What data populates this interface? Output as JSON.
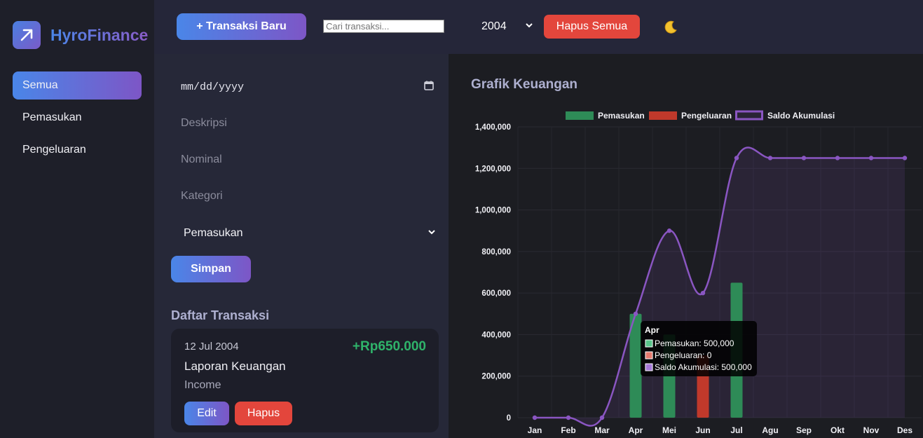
{
  "app": {
    "name": "HyroFinance"
  },
  "sidebar": {
    "items": [
      {
        "label": "Semua",
        "active": true
      },
      {
        "label": "Pemasukan",
        "active": false
      },
      {
        "label": "Pengeluaran",
        "active": false
      }
    ]
  },
  "header": {
    "new_button": "+ Transaksi Baru",
    "search_placeholder": "Cari transaksi...",
    "year": "2004",
    "clear_button": "Hapus Semua",
    "theme_icon": "moon-icon"
  },
  "form": {
    "date_placeholder": "mm/dd/yyyy",
    "description_placeholder": "Deskripsi",
    "amount_placeholder": "Nominal",
    "category_placeholder": "Kategori",
    "type_selected": "Pemasukan",
    "save_button": "Simpan"
  },
  "transactions": {
    "title": "Daftar Transaksi",
    "items": [
      {
        "date": "12 Jul 2004",
        "amount": "+Rp650.000",
        "description": "Laporan Keuangan",
        "category": "Income",
        "edit_label": "Edit",
        "delete_label": "Hapus"
      }
    ]
  },
  "colors": {
    "accent_start": "#4a86e8",
    "accent_end": "#7d56c6",
    "danger": "#e3463c",
    "income": "#2e8b57",
    "expense": "#c0392b",
    "balance": "#8a56c2"
  },
  "chart_title": "Grafik Keuangan",
  "chart_data": {
    "type": "bar",
    "categories": [
      "Jan",
      "Feb",
      "Mar",
      "Apr",
      "Mei",
      "Jun",
      "Jul",
      "Agu",
      "Sep",
      "Okt",
      "Nov",
      "Des"
    ],
    "series": [
      {
        "name": "Pemasukan",
        "type": "bar",
        "color": "#2e8b57",
        "values": [
          0,
          0,
          0,
          500000,
          400000,
          0,
          650000,
          0,
          0,
          0,
          0,
          0
        ]
      },
      {
        "name": "Pengeluaran",
        "type": "bar",
        "color": "#c0392b",
        "values": [
          0,
          0,
          0,
          0,
          0,
          300000,
          0,
          0,
          0,
          0,
          0,
          0
        ]
      },
      {
        "name": "Saldo Akumulasi",
        "type": "line",
        "color": "#8a56c2",
        "values": [
          0,
          0,
          0,
          500000,
          900000,
          600000,
          1250000,
          1250000,
          1250000,
          1250000,
          1250000,
          1250000
        ]
      }
    ],
    "ylim": [
      0,
      1400000
    ],
    "yticks": [
      "1,400,000",
      "1,200,000",
      "1,000,000",
      "800,000",
      "600,000",
      "400,000",
      "200,000",
      "0"
    ],
    "legend_position": "top",
    "grid": true,
    "tooltip": {
      "title": "Apr",
      "lines": [
        "Pemasukan: 500,000",
        "Pengeluaran: 0",
        "Saldo Akumulasi: 500,000"
      ]
    }
  }
}
